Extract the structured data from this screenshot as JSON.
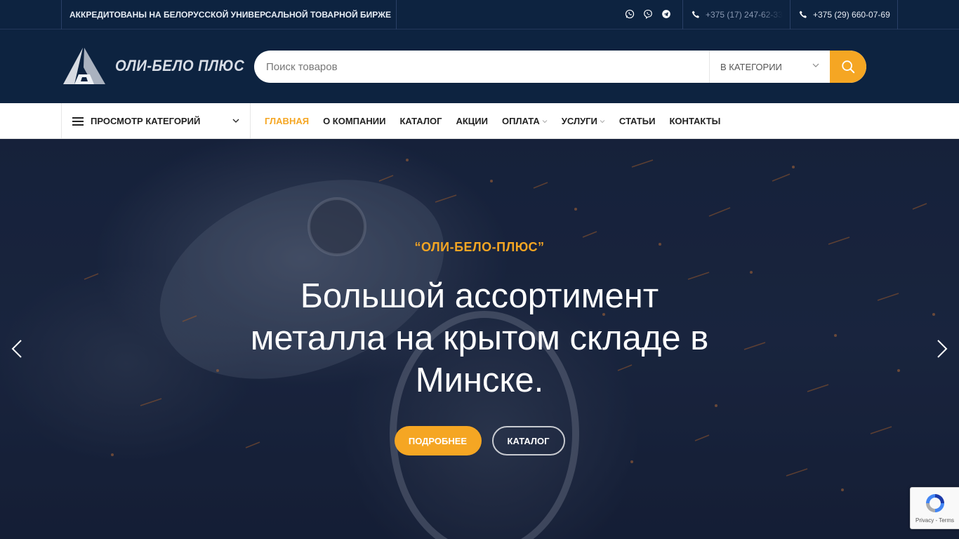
{
  "topbar": {
    "notice": "АККРЕДИТОВАНЫ НА БЕЛОРУССКОЙ УНИВЕРСАЛЬНОЙ ТОВАРНОЙ БИРЖЕ",
    "social": [
      "whatsapp-icon",
      "viber-icon",
      "telegram-icon"
    ],
    "phone1": "+375 (17) 247-62-33",
    "phone2": "+375 (29) 660-07-69"
  },
  "header": {
    "logo_text": "ОЛИ-БЕЛО ПЛЮС",
    "search_placeholder": "Поиск товаров",
    "search_category": "В КАТЕГОРИИ"
  },
  "nav": {
    "categories_label": "ПРОСМОТР КАТЕГОРИЙ",
    "items": [
      {
        "label": "ГЛАВНАЯ",
        "active": true,
        "dropdown": false
      },
      {
        "label": "О КОМПАНИИ",
        "active": false,
        "dropdown": false
      },
      {
        "label": "КАТАЛОГ",
        "active": false,
        "dropdown": false
      },
      {
        "label": "АКЦИИ",
        "active": false,
        "dropdown": false
      },
      {
        "label": "ОПЛАТА",
        "active": false,
        "dropdown": true
      },
      {
        "label": "УСЛУГИ",
        "active": false,
        "dropdown": true
      },
      {
        "label": "СТАТЬИ",
        "active": false,
        "dropdown": false
      },
      {
        "label": "КОНТАКТЫ",
        "active": false,
        "dropdown": false
      }
    ]
  },
  "hero": {
    "eyebrow": "“ОЛИ-БЕЛО-ПЛЮС”",
    "title": "Большой ассортимент металла на крытом складе в Минске.",
    "button_primary": "ПОДРОБНЕЕ",
    "button_secondary": "КАТАЛОГ"
  },
  "recaptcha": {
    "links": "Privacy - Terms"
  },
  "colors": {
    "brand_dark": "#0d2340",
    "accent": "#f5a623"
  }
}
